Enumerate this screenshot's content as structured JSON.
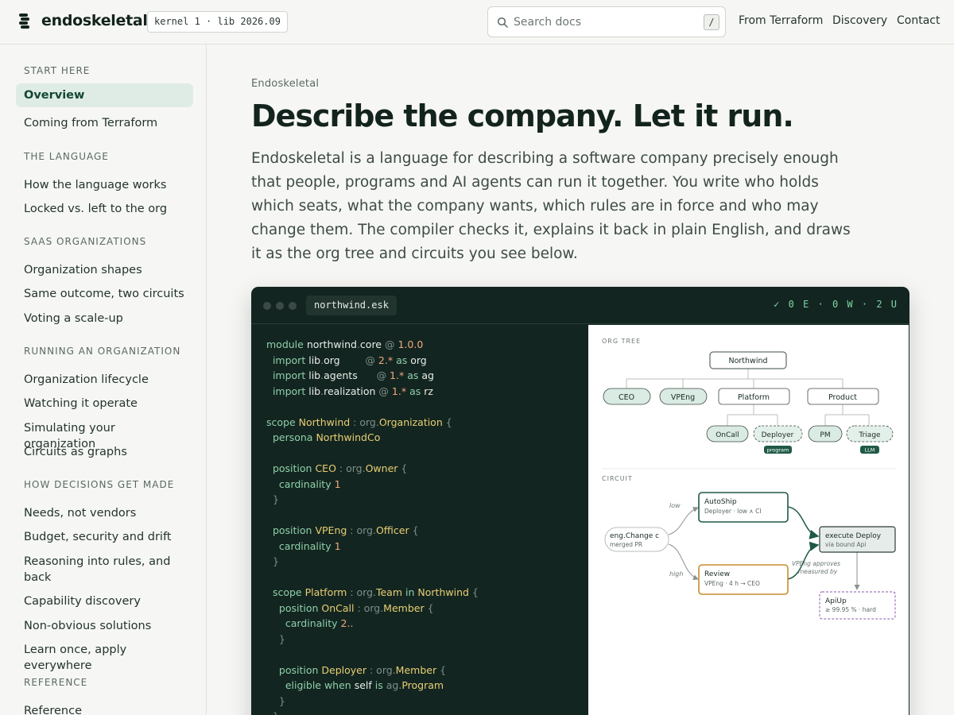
{
  "header": {
    "brand": "endoskeletal",
    "version": "kernel 1 · lib 2026.09",
    "search_placeholder": "Search docs",
    "search_shortcut": "/",
    "nav": [
      "From Terraform",
      "Discovery",
      "Contact"
    ]
  },
  "sidebar": {
    "sections": [
      {
        "title": "START HERE",
        "items": [
          "Overview",
          "Coming from Terraform"
        ]
      },
      {
        "title": "THE LANGUAGE",
        "items": [
          "How the language works",
          "Locked vs. left to the org"
        ]
      },
      {
        "title": "SAAS ORGANIZATIONS",
        "items": [
          "Organization shapes",
          "Same outcome, two circuits",
          "Voting a scale-up"
        ]
      },
      {
        "title": "RUNNING AN ORGANIZATION",
        "items": [
          "Organization lifecycle",
          "Watching it operate",
          "Simulating your organization",
          "Circuits as graphs"
        ]
      },
      {
        "title": "HOW DECISIONS GET MADE",
        "items": [
          "Needs, not vendors",
          "Budget, security and drift",
          "Reasoning into rules, and back",
          "Capability discovery",
          "Non-obvious solutions",
          "Learn once, apply everywhere"
        ]
      },
      {
        "title": "REFERENCE",
        "items": [
          "Reference"
        ]
      }
    ],
    "active": "Overview"
  },
  "main": {
    "eyebrow": "Endoskeletal",
    "title": "Describe the company. Let it run.",
    "intro": "Endoskeletal is a language for describing a software company precisely enough that people, programs and AI agents can run it together. You write who holds which seats, what the company wants, which rules are in force and who may change them. The compiler checks it, explains it back in plain English, and draws it as the org tree and circuits you see below."
  },
  "panel": {
    "filename": "northwind.esk",
    "status": "✓ 0 E · 0 W · 2 U",
    "code_lines": [
      "module northwind.core @ 1.0.0",
      "  import lib.org       @ 2.* as org",
      "  import lib.agents     @ 1.* as ag",
      "  import lib.realization @ 1.* as rz",
      "",
      "scope Northwind : org.Organization {",
      "  persona NorthwindCo",
      "",
      "  position CEO : org.Owner {",
      "    cardinality 1",
      "  }",
      "",
      "  position VPEng : org.Officer {",
      "    cardinality 1",
      "  }",
      "",
      "  scope Platform : org.Team in Northwind {",
      "    position OnCall : org.Member {",
      "      cardinality 2..",
      "    }",
      "",
      "    position Deployer : org.Member {",
      "      eligible when self is ag.Program",
      "    }",
      "  }"
    ]
  },
  "org_tree": {
    "label": "ORG TREE",
    "root": "Northwind",
    "level1": [
      "CEO",
      "VPEng",
      "Platform",
      "Product"
    ],
    "platform_children": [
      "OnCall",
      "Deployer"
    ],
    "product_children": [
      "PM",
      "Triage"
    ],
    "badges": {
      "Deployer": "program",
      "Triage": "LLM"
    }
  },
  "circuit": {
    "label": "CIRCUIT",
    "input": {
      "title": "eng.Change c",
      "sub": "merged PR"
    },
    "autoship": {
      "title": "AutoShip",
      "sub": "Deployer · low ∧ CI"
    },
    "review": {
      "title": "Review",
      "sub": "VPEng · 4 h → CEO"
    },
    "execute": {
      "title": "execute Deploy",
      "sub": "via bound Api"
    },
    "apiup": {
      "title": "ApiUp",
      "sub": "≥ 99.95 % · hard"
    },
    "edge_low": "low",
    "edge_high": "high",
    "approval_note_1": "VPEng approves",
    "approval_note_2": "measured by"
  }
}
